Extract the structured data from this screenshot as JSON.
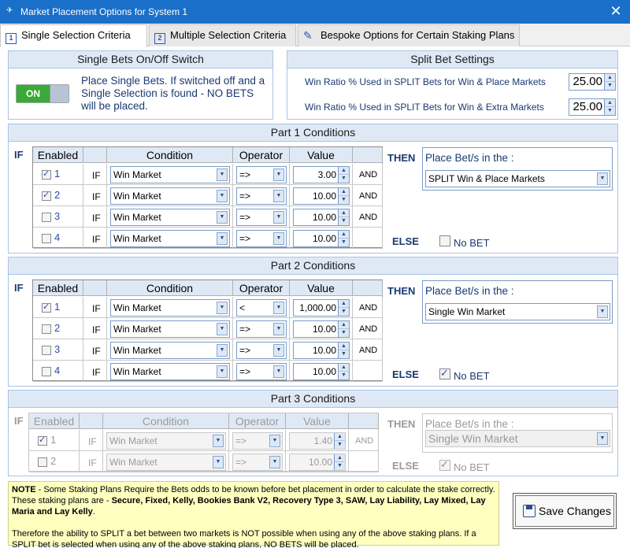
{
  "window": {
    "title": "Market Placement Options for System 1",
    "close_glyph": "✕"
  },
  "tabs": [
    {
      "label": "Single Selection Criteria",
      "icon": "1"
    },
    {
      "label": "Multiple Selection Criteria",
      "icon": "2"
    },
    {
      "label": "Bespoke Options for Certain Staking Plans",
      "icon": "pencil"
    }
  ],
  "single_bets": {
    "title": "Single Bets On/Off Switch",
    "toggle_label": "ON",
    "description": "Place Single Bets. If switched off and a Single Selection is found - NO BETS will be placed."
  },
  "split_bet": {
    "title": "Split Bet Settings",
    "rows": [
      {
        "label": "Win Ratio % Used in SPLIT Bets for Win & Place Markets",
        "value": "25.00"
      },
      {
        "label": "Win Ratio % Used in SPLIT Bets for Win & Extra Markets",
        "value": "25.00"
      }
    ]
  },
  "common": {
    "if": "IF",
    "then": "THEN",
    "else": "ELSE",
    "and": "AND",
    "col_enabled": "Enabled",
    "col_condition": "Condition",
    "col_operator": "Operator",
    "col_value": "Value",
    "place_label": "Place Bet/s in the :",
    "no_bet": "No BET"
  },
  "part1": {
    "title": "Part 1 Conditions",
    "rows": [
      {
        "n": "1",
        "checked": true,
        "condition": "Win Market",
        "operator": "=>",
        "value": "3.00",
        "and": "AND"
      },
      {
        "n": "2",
        "checked": true,
        "condition": "Win Market",
        "operator": "=>",
        "value": "10.00",
        "and": "AND"
      },
      {
        "n": "3",
        "checked": false,
        "condition": "Win Market",
        "operator": "=>",
        "value": "10.00",
        "and": "AND"
      },
      {
        "n": "4",
        "checked": false,
        "condition": "Win Market",
        "operator": "=>",
        "value": "10.00",
        "and": ""
      }
    ],
    "place_value": "SPLIT Win & Place Markets",
    "no_bet_checked": false
  },
  "part2": {
    "title": "Part 2 Conditions",
    "rows": [
      {
        "n": "1",
        "checked": true,
        "condition": "Win Market",
        "operator": "<",
        "value": "1,000.00",
        "and": "AND"
      },
      {
        "n": "2",
        "checked": false,
        "condition": "Win Market",
        "operator": "=>",
        "value": "10.00",
        "and": "AND"
      },
      {
        "n": "3",
        "checked": false,
        "condition": "Win Market",
        "operator": "=>",
        "value": "10.00",
        "and": "AND"
      },
      {
        "n": "4",
        "checked": false,
        "condition": "Win Market",
        "operator": "=>",
        "value": "10.00",
        "and": ""
      }
    ],
    "place_value": "Single Win Market",
    "no_bet_checked": true
  },
  "part3": {
    "title": "Part 3 Conditions",
    "rows": [
      {
        "n": "1",
        "checked": true,
        "condition": "Win Market",
        "operator": "=>",
        "value": "1.40",
        "and": "AND"
      },
      {
        "n": "2",
        "checked": false,
        "condition": "Win Market",
        "operator": "=>",
        "value": "10.00",
        "and": ""
      }
    ],
    "place_value": "Single Win Market",
    "no_bet_checked": true
  },
  "note": {
    "p1_prefix": "NOTE",
    "p1_text": " - Some Staking Plans Require the Bets odds to be known before bet placement in order to calculate the stake correctly. These staking plans are - ",
    "p1_plans": "Secure, Fixed, Kelly, Bookies Bank V2, Recovery Type 3, SAW, Lay Liability, Lay Mixed, Lay Maria and Lay Kelly",
    "p1_end": ".",
    "p2": "Therefore the ability to SPLIT a bet between two markets is NOT possible when using any of the above staking plans. If a SPLIT bet is selected when using any of the above staking plans, NO BETS will be placed."
  },
  "save_button": "Save Changes",
  "colors": {
    "titlebar": "#1a6fc9",
    "panel_header": "#dfe9f6",
    "toggle_on": "#3ba935",
    "note_bg": "#ffffc0"
  }
}
